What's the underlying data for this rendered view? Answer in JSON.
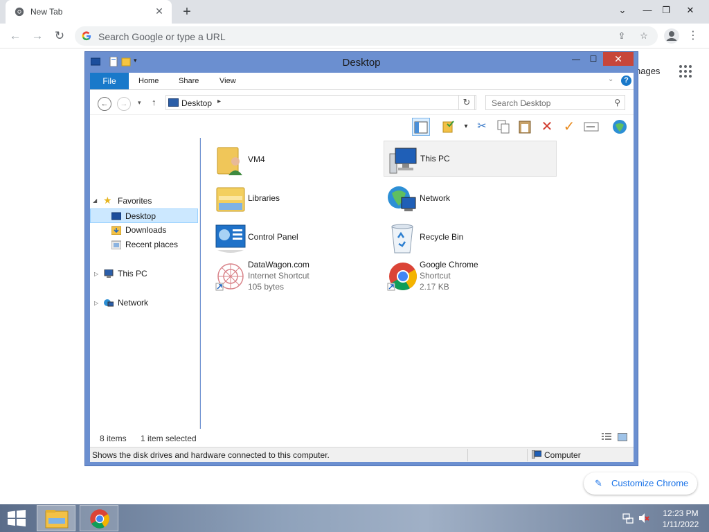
{
  "browser": {
    "tab_title": "New Tab",
    "omnibox_placeholder": "Search Google or type a URL",
    "ntp_images_partial": "nages",
    "customize_label": "Customize Chrome"
  },
  "explorer": {
    "title": "Desktop",
    "ribbon_tabs": {
      "file": "File",
      "home": "Home",
      "share": "Share",
      "view": "View"
    },
    "address": "Desktop",
    "search_placeholder": "Search Desktop",
    "nav": {
      "favorites": "Favorites",
      "desktop": "Desktop",
      "downloads": "Downloads",
      "recent": "Recent places",
      "this_pc": "This PC",
      "network": "Network"
    },
    "items": [
      {
        "name": "VM4"
      },
      {
        "name": "This PC"
      },
      {
        "name": "Libraries"
      },
      {
        "name": "Network"
      },
      {
        "name": "Control Panel"
      },
      {
        "name": "Recycle Bin"
      },
      {
        "name": "DataWagon.com",
        "type": "Internet Shortcut",
        "size": "105 bytes"
      },
      {
        "name": "Google Chrome",
        "type": "Shortcut",
        "size": "2.17 KB"
      }
    ],
    "status": {
      "count": "8 items",
      "selected": "1 item selected",
      "description": "Shows the disk drives and hardware connected to this computer.",
      "location": "Computer"
    }
  },
  "taskbar": {
    "time": "12:23 PM",
    "date": "1/11/2022"
  },
  "colors": {
    "explorer_frame": "#6b8fd0",
    "file_tab": "#1979ca",
    "close_button": "#c7463a",
    "selection": "#cce8ff",
    "chrome_link": "#1a73e8"
  }
}
